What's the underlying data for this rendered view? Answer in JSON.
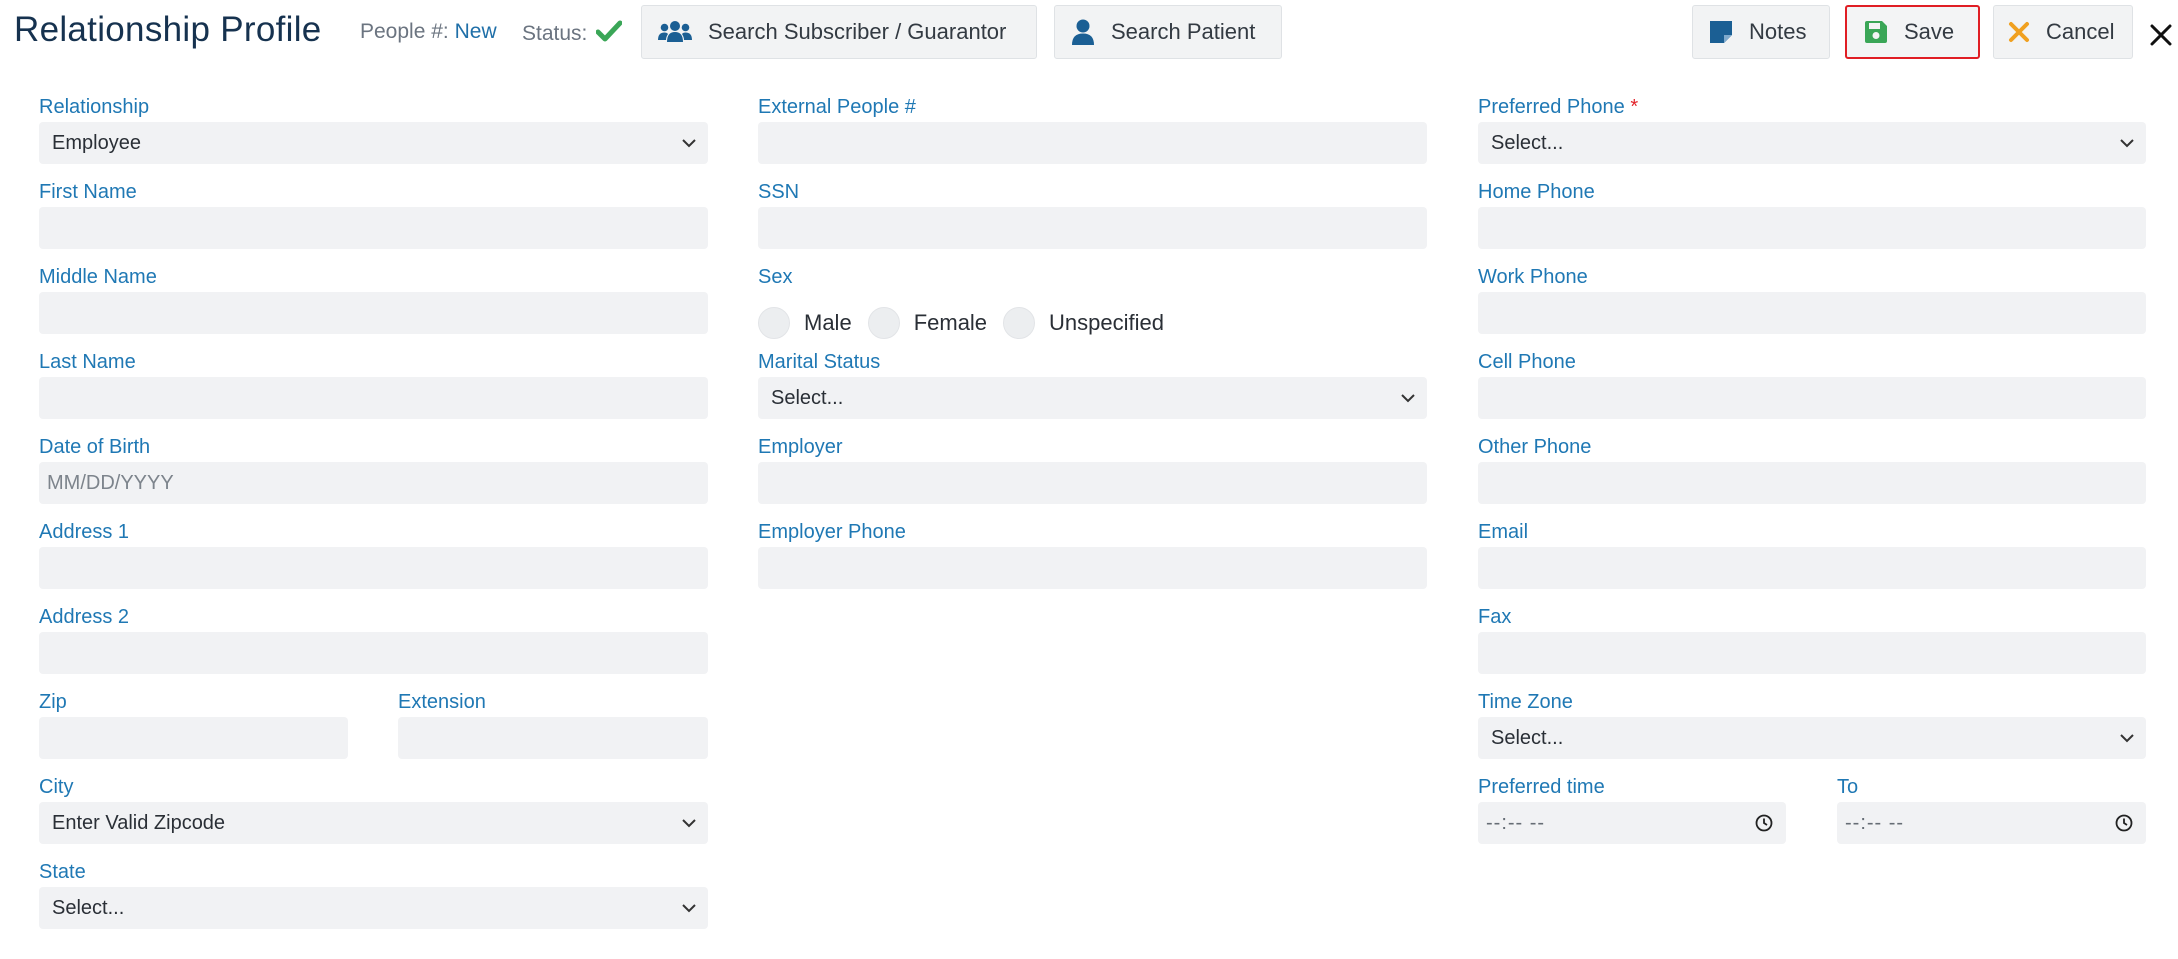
{
  "header": {
    "title": "Relationship Profile",
    "people_label": "People #:",
    "people_value": "New",
    "status_label": "Status:",
    "status_icon": "check-icon",
    "status_color": "#3aa657"
  },
  "toolbar": {
    "search_subscriber_label": "Search Subscriber / Guarantor",
    "search_patient_label": "Search Patient",
    "notes_label": "Notes",
    "save_label": "Save",
    "cancel_label": "Cancel",
    "close_icon": "close-icon"
  },
  "colors": {
    "title": "#16324f",
    "label": "#1f78b4",
    "required": "#e2242b",
    "field_bg": "#f1f2f4",
    "save_highlight": "#e01e24",
    "save_icon": "#3aa657",
    "cancel_icon": "#f0a020",
    "icon_blue": "#1b5f94"
  },
  "form": {
    "relationship": {
      "label": "Relationship",
      "value": "Employee"
    },
    "first_name": {
      "label": "First Name",
      "value": ""
    },
    "middle_name": {
      "label": "Middle Name",
      "value": ""
    },
    "last_name": {
      "label": "Last Name",
      "value": ""
    },
    "dob": {
      "label": "Date of Birth",
      "placeholder": "MM/DD/YYYY"
    },
    "address1": {
      "label": "Address 1",
      "value": ""
    },
    "address2": {
      "label": "Address 2",
      "value": ""
    },
    "zip": {
      "label": "Zip",
      "value": ""
    },
    "extension": {
      "label": "Extension",
      "value": ""
    },
    "city": {
      "label": "City",
      "value": "Enter Valid Zipcode"
    },
    "state": {
      "label": "State",
      "value": "Select..."
    },
    "external_people": {
      "label": "External People #",
      "value": ""
    },
    "ssn": {
      "label": "SSN",
      "value": ""
    },
    "sex": {
      "label": "Sex",
      "options": [
        "Male",
        "Female",
        "Unspecified"
      ]
    },
    "marital_status": {
      "label": "Marital Status",
      "value": "Select..."
    },
    "employer": {
      "label": "Employer",
      "value": ""
    },
    "employer_phone": {
      "label": "Employer Phone",
      "value": ""
    },
    "preferred_phone": {
      "label": "Preferred Phone",
      "required_mark": "*",
      "value": "Select..."
    },
    "home_phone": {
      "label": "Home Phone",
      "value": ""
    },
    "work_phone": {
      "label": "Work Phone",
      "value": ""
    },
    "cell_phone": {
      "label": "Cell Phone",
      "value": ""
    },
    "other_phone": {
      "label": "Other Phone",
      "value": ""
    },
    "email": {
      "label": "Email",
      "value": ""
    },
    "fax": {
      "label": "Fax",
      "value": ""
    },
    "time_zone": {
      "label": "Time Zone",
      "value": "Select..."
    },
    "preferred_time": {
      "label": "Preferred time",
      "value": "--:-- --"
    },
    "to_time": {
      "label": "To",
      "value": "--:-- --"
    }
  }
}
